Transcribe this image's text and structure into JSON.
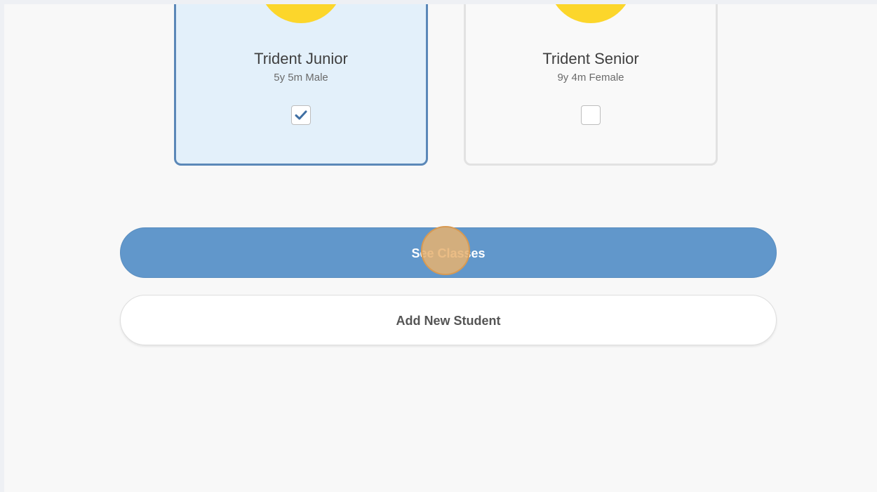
{
  "students": [
    {
      "name": "Trident Junior",
      "details": "5y 5m Male",
      "selected": true
    },
    {
      "name": "Trident Senior",
      "details": "9y 4m Female",
      "selected": false
    }
  ],
  "actions": {
    "see_classes_label": "See Classes",
    "add_student_label": "Add New Student"
  },
  "colors": {
    "primary": "#6197cb",
    "avatar": "#fcd62b",
    "selected_border": "#5b88b8",
    "selected_bg": "#e3f0fa"
  }
}
